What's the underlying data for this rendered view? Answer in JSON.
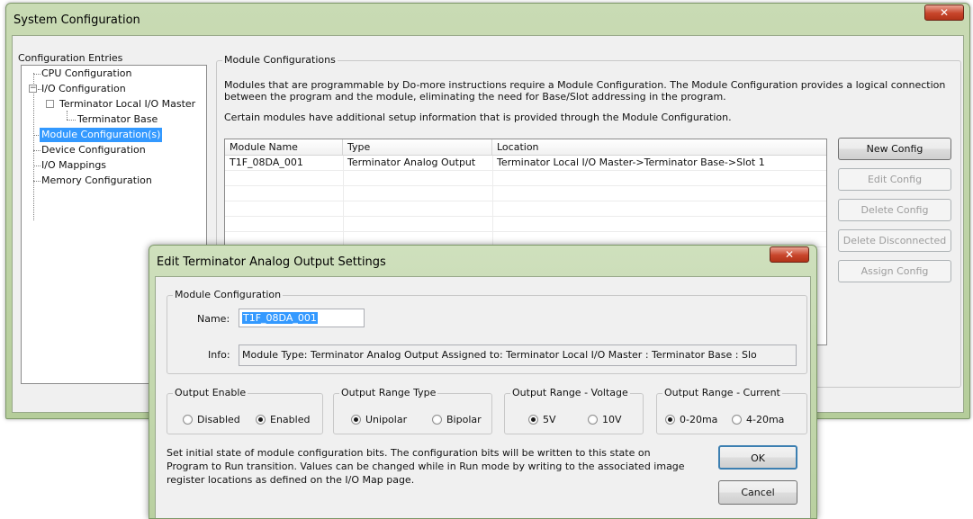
{
  "main_window": {
    "title": "System Configuration",
    "close_glyph": "✕",
    "config_entries": {
      "legend": "Configuration Entries",
      "tree": [
        "CPU Configuration",
        "I/O Configuration",
        "Terminator Local I/O Master",
        "Terminator Base",
        "Module Configuration(s)",
        "Device Configuration",
        "I/O Mappings",
        "Memory Configuration"
      ],
      "expander_minus": "−",
      "expander_empty": ""
    },
    "module_configurations": {
      "legend": "Module Configurations",
      "description_line1": "Modules that are programmable by Do-more instructions require a Module Configuration. The Module Configuration provides a logical connection",
      "description_line2": "between the program and the module, eliminating the need for Base/Slot addressing in the program.",
      "description_line3": "Certain modules have additional setup information that is provided through the Module Configuration.",
      "columns": [
        "Module Name",
        "Type",
        "Location"
      ],
      "rows": [
        [
          "T1F_08DA_001",
          "Terminator Analog Output",
          "Terminator Local I/O Master->Terminator Base->Slot 1"
        ]
      ]
    },
    "buttons": {
      "new_config": "New Config",
      "edit_config": "Edit Config",
      "delete_config": "Delete Config",
      "delete_disconnected": "Delete Disconnected",
      "assign_config": "Assign Config"
    }
  },
  "dialog": {
    "title": "Edit Terminator Analog Output Settings",
    "close_glyph": "✕",
    "module_configuration": {
      "legend": "Module Configuration",
      "name_label": "Name:",
      "name_value": "T1F_08DA_001",
      "info_label": "Info:",
      "info_value": "Module Type: Terminator Analog Output   Assigned to: Terminator Local I/O Master : Terminator Base : Slo"
    },
    "output_enable": {
      "legend": "Output Enable",
      "options": [
        "Disabled",
        "Enabled"
      ],
      "selected": "Enabled"
    },
    "output_range_type": {
      "legend": "Output Range Type",
      "options": [
        "Unipolar",
        "Bipolar"
      ],
      "selected": "Unipolar"
    },
    "output_range_voltage": {
      "legend": "Output Range - Voltage",
      "options": [
        "5V",
        "10V"
      ],
      "selected": "5V"
    },
    "output_range_current": {
      "legend": "Output Range - Current",
      "options": [
        "0-20ma",
        "4-20ma"
      ],
      "selected": "0-20ma"
    },
    "note_line1": "Set initial state of module configuration bits. The configuration bits will be written to this state on",
    "note_line2": "Program to Run transition. Values can be changed while in Run mode by writing to the associated image",
    "note_line3": "register locations as defined on the I/O Map page.",
    "ok_label": "OK",
    "cancel_label": "Cancel"
  }
}
